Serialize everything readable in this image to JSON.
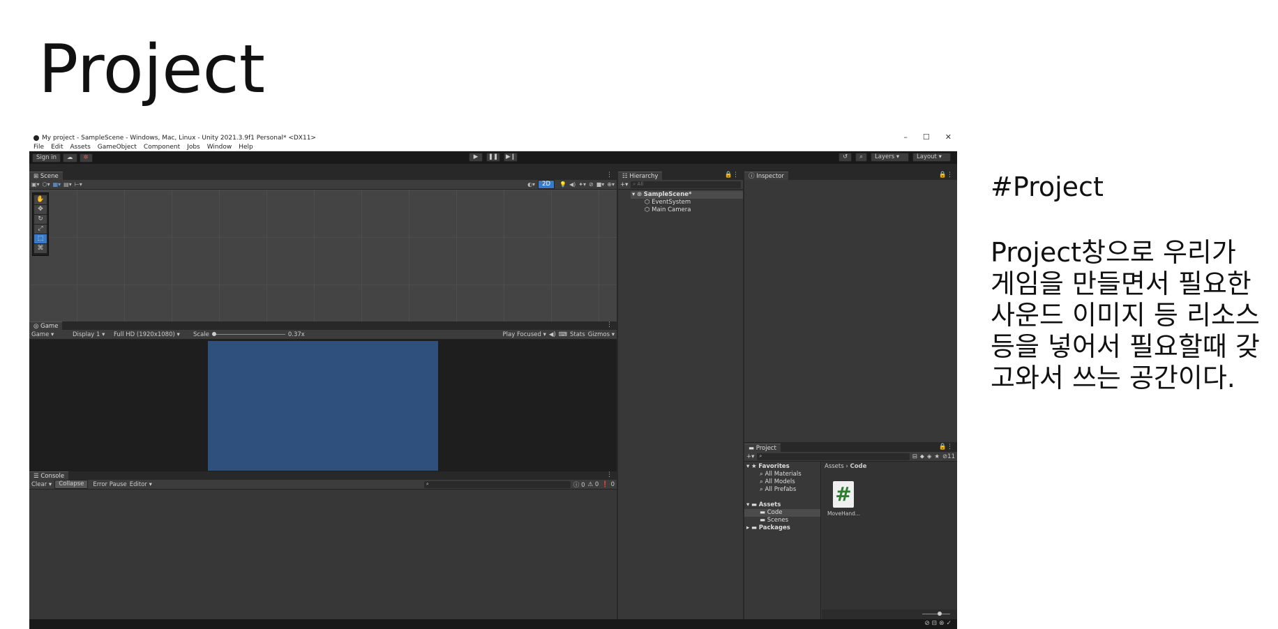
{
  "slide": {
    "title": "Project",
    "notes_heading": "#Project",
    "notes_body": "Project창으로 우리가 게임을 만들면서 필요한 사운드 이미지 등 리소스등을 넣어서 필요할때 갖고와서 쓰는 공간이다."
  },
  "window": {
    "title": "My project - SampleScene - Windows, Mac, Linux - Unity 2021.3.9f1 Personal* <DX11>",
    "controls": {
      "minimize": "–",
      "maximize": "☐",
      "close": "✕"
    }
  },
  "menu": [
    "File",
    "Edit",
    "Assets",
    "GameObject",
    "Component",
    "Jobs",
    "Window",
    "Help"
  ],
  "toolbar": {
    "sign_in": "Sign in",
    "layers": "Layers",
    "layout": "Layout"
  },
  "scene": {
    "tab": "Scene",
    "two_d": "2D"
  },
  "game": {
    "tab": "Game",
    "mode": "Game",
    "display": "Display 1",
    "resolution": "Full HD (1920x1080)",
    "scale_label": "Scale",
    "scale_value": "0.37x",
    "play_focused": "Play Focused",
    "stats": "Stats",
    "gizmos": "Gizmos",
    "render_color": "#2f4f7c"
  },
  "console": {
    "tab": "Console",
    "clear": "Clear",
    "collapse": "Collapse",
    "error_pause": "Error Pause",
    "editor": "Editor",
    "info_count": "0",
    "warn_count": "0",
    "error_count": "0"
  },
  "hierarchy": {
    "tab": "Hierarchy",
    "search_placeholder": "All",
    "scene_name": "SampleScene*",
    "items": [
      "EventSystem",
      "Main Camera"
    ]
  },
  "inspector": {
    "tab": "Inspector"
  },
  "project": {
    "tab": "Project",
    "hidden_count": "11",
    "favorites_label": "Favorites",
    "favorites": [
      "All Materials",
      "All Models",
      "All Prefabs"
    ],
    "assets_label": "Assets",
    "asset_folders": [
      "Code",
      "Scenes"
    ],
    "packages_label": "Packages",
    "breadcrumb_root": "Assets",
    "breadcrumb_current": "Code",
    "file_name": "MoveHand..."
  }
}
